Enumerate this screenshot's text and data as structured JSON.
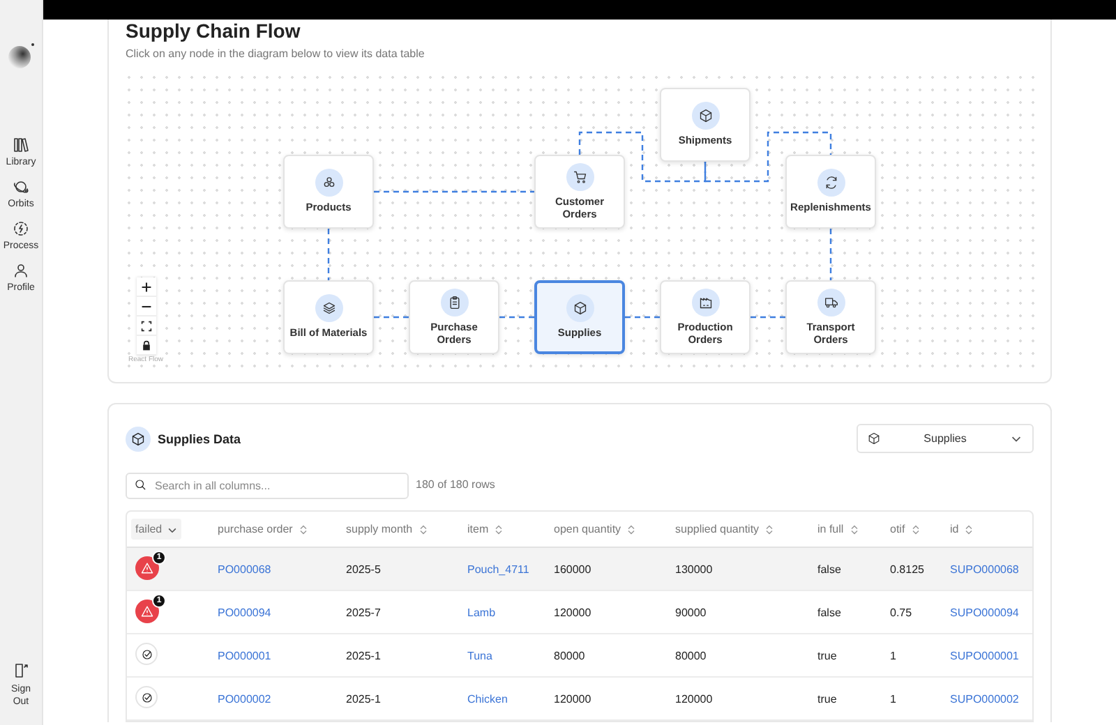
{
  "sidebar": {
    "items": [
      {
        "label": "Library"
      },
      {
        "label": "Orbits"
      },
      {
        "label": "Process"
      },
      {
        "label": "Profile"
      }
    ],
    "footer": {
      "label": "Sign Out"
    }
  },
  "flow": {
    "title": "Supply Chain Flow",
    "subtitle": "Click on any node in the diagram below to view its data table",
    "nodes": [
      {
        "label": "Products",
        "selected": false
      },
      {
        "label": "Customer Orders",
        "selected": false
      },
      {
        "label": "Shipments",
        "selected": false
      },
      {
        "label": "Replenishments",
        "selected": false
      },
      {
        "label": "Bill of Materials",
        "selected": false
      },
      {
        "label": "Purchase Orders",
        "selected": false
      },
      {
        "label": "Supplies",
        "selected": true
      },
      {
        "label": "Production Orders",
        "selected": false
      },
      {
        "label": "Transport Orders",
        "selected": false
      }
    ],
    "attribution": "React Flow"
  },
  "data_panel": {
    "title": "Supplies Data",
    "dropdown": {
      "value": "Supplies"
    },
    "search": {
      "placeholder": "Search in all columns..."
    },
    "row_count": "180 of 180 rows",
    "table": {
      "columns": [
        {
          "label": "failed",
          "kind": "status",
          "sorted": true
        },
        {
          "label": "purchase order",
          "kind": "link",
          "sorted": false
        },
        {
          "label": "supply month",
          "kind": "text",
          "sorted": false
        },
        {
          "label": "item",
          "kind": "link",
          "sorted": false
        },
        {
          "label": "open quantity",
          "kind": "text",
          "sorted": false
        },
        {
          "label": "supplied quantity",
          "kind": "text",
          "sorted": false
        },
        {
          "label": "in full",
          "kind": "text",
          "sorted": false
        },
        {
          "label": "otif",
          "kind": "text",
          "sorted": false
        },
        {
          "label": "id",
          "kind": "link",
          "sorted": false
        }
      ],
      "rows": [
        {
          "passed": false,
          "issues": "1",
          "highlighted": true,
          "cells": [
            "",
            "PO000068",
            "2025-5",
            "Pouch_4711",
            "160000",
            "130000",
            "false",
            "0.8125",
            "SUPO000068"
          ]
        },
        {
          "passed": false,
          "issues": "1",
          "highlighted": false,
          "cells": [
            "",
            "PO000094",
            "2025-7",
            "Lamb",
            "120000",
            "90000",
            "false",
            "0.75",
            "SUPO000094"
          ]
        },
        {
          "passed": true,
          "highlighted": false,
          "cells": [
            "",
            "PO000001",
            "2025-1",
            "Tuna",
            "80000",
            "80000",
            "true",
            "1",
            "SUPO000001"
          ]
        },
        {
          "passed": true,
          "highlighted": false,
          "cells": [
            "",
            "PO000002",
            "2025-1",
            "Chicken",
            "120000",
            "120000",
            "true",
            "1",
            "SUPO000002"
          ]
        }
      ]
    }
  }
}
